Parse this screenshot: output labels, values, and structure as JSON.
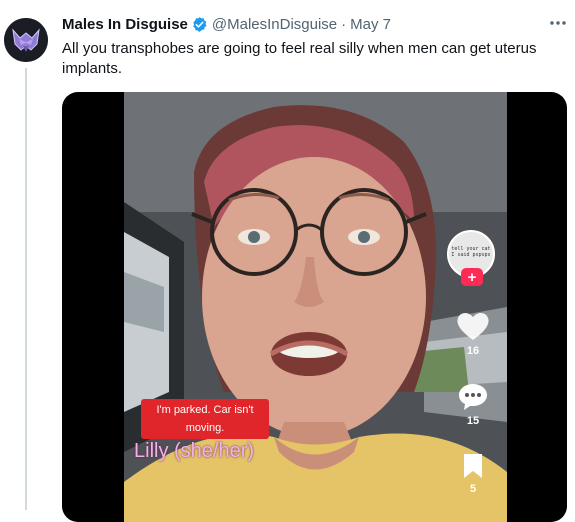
{
  "author": {
    "name": "Males In Disguise",
    "handle": "@MalesInDisguise",
    "separator": "·",
    "date": "May 7",
    "avatar_icon": "decepticon-logo-icon"
  },
  "tweet": {
    "text": "All you transphobes are going to feel real silly when men can get uterus implants."
  },
  "video": {
    "caption": "I'm parked. Car isn't moving.",
    "name_tag": "Lilly (she/her)",
    "follow_avatar_text": "tell your cat I said pspsps",
    "likes": "16",
    "comments": "15",
    "saves": "5"
  },
  "colors": {
    "verified": "#1d9bf0",
    "text": "#0f1419",
    "muted": "#536471",
    "caption_bg": "#e0262b",
    "name_tag": "#f1b3e6",
    "tiktok_plus": "#fe2c55"
  }
}
